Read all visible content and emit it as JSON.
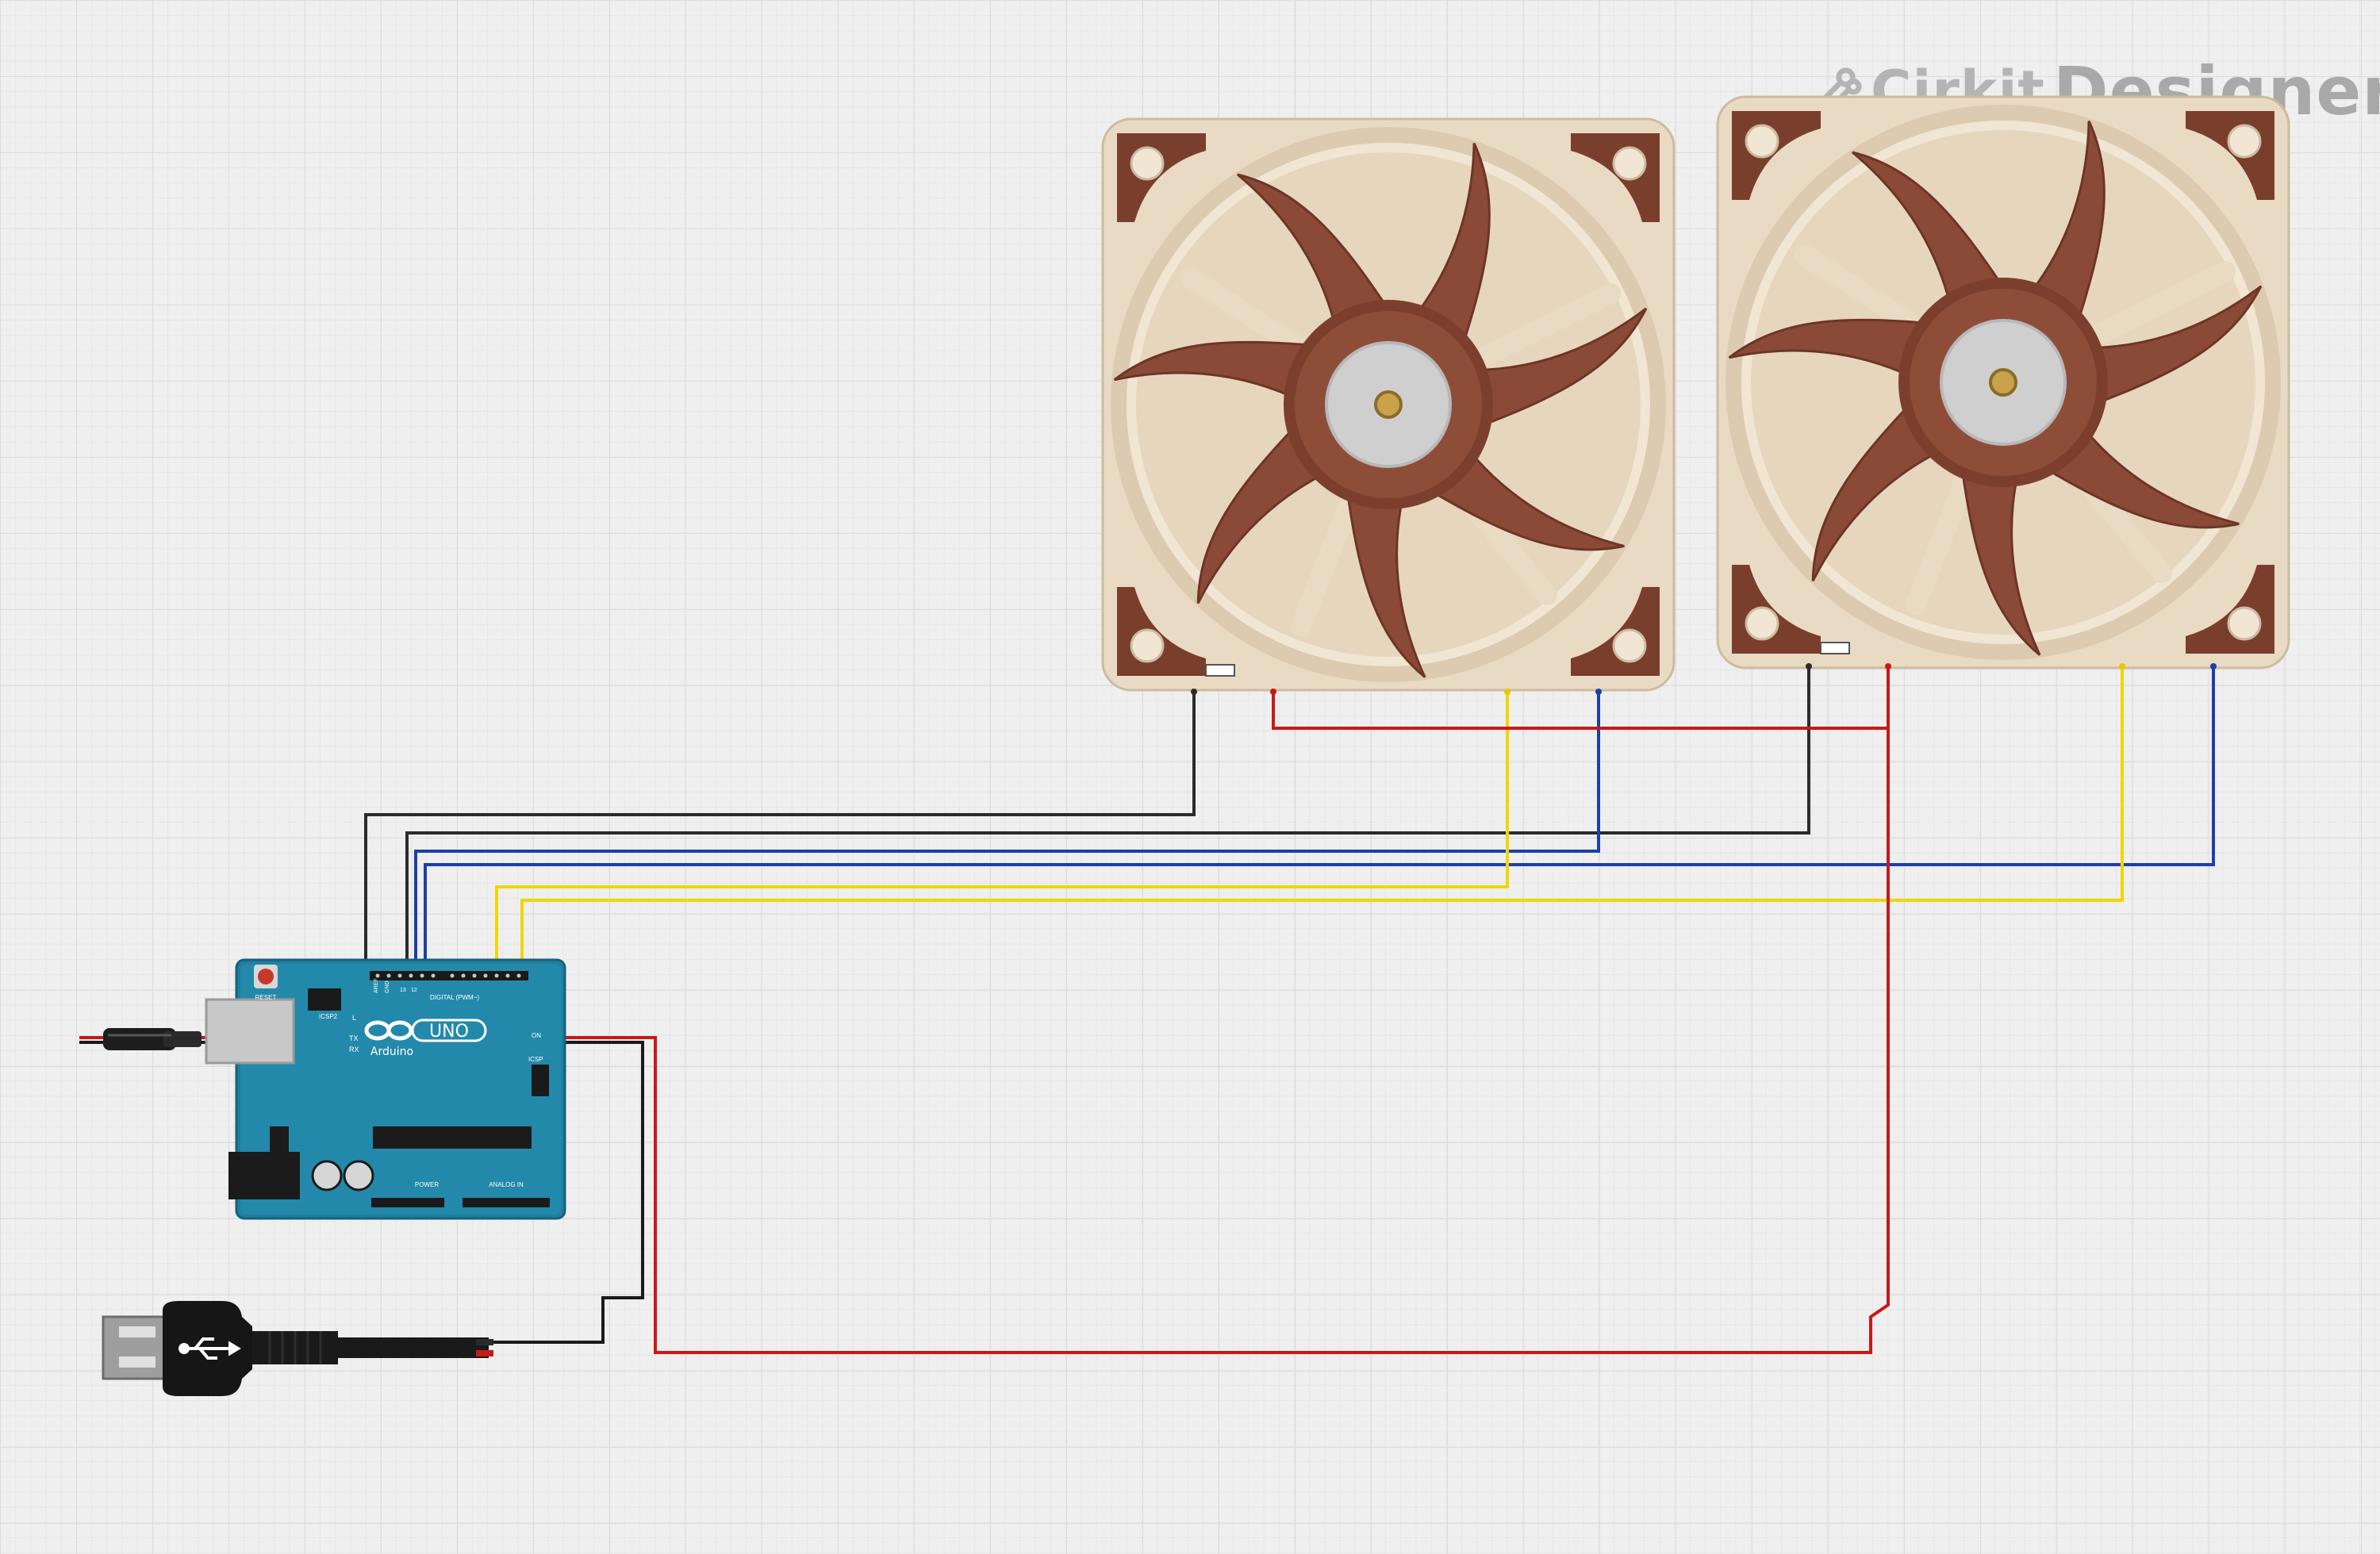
{
  "brand": {
    "word1": "Cirkit",
    "word2": "Designer"
  },
  "arduino": {
    "reset_label": "RESET",
    "icsp_label": "ICSP2",
    "digital_label": "DIGITAL (PWM~)",
    "board_name": "UNO",
    "brand_label": "Arduino",
    "led_l": "L",
    "led_tx": "TX",
    "led_rx": "RX",
    "on_label": "ON",
    "icsp_right": "ICSP",
    "power_label": "POWER",
    "analog_label": "ANALOG IN",
    "aref": "AREF",
    "gnd": "GND",
    "pin13": "13",
    "pin12": "12"
  },
  "components": [
    "arduino-uno",
    "fan-1",
    "fan-2",
    "usb-cable",
    "inline-connector"
  ],
  "wire_colors": {
    "gnd": "#2b2b2b",
    "vcc": "#c91818",
    "pwm": "#f2d600",
    "tach": "#1e3fa8"
  },
  "colors": {
    "fan_frame": "#e8d9c3",
    "fan_blade": "#8a4a37",
    "fan_pad": "#7a3e2c",
    "board": "#1f7fa0",
    "grid": "#dcdcdc"
  }
}
